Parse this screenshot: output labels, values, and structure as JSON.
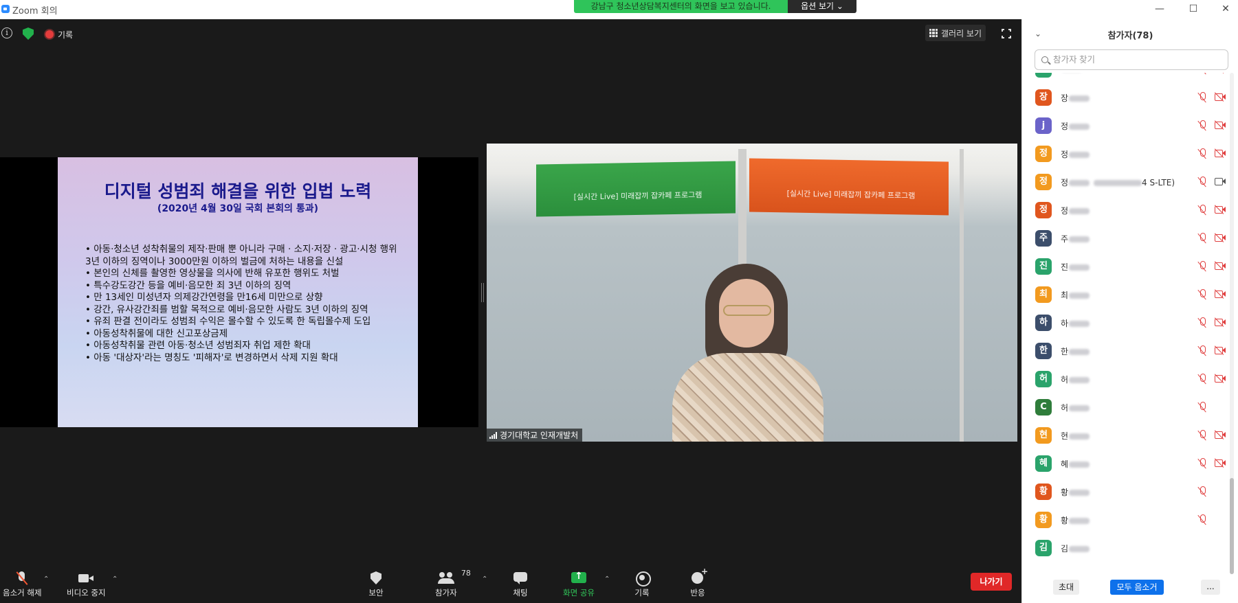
{
  "window": {
    "title": "Zoom 회의",
    "share_banner": "강남구 청소년상담복지센터의 화면을 보고 있습니다.",
    "view_options": "옵션 보기 ⌄",
    "minimize": "—",
    "maximize": "☐",
    "close": "✕"
  },
  "meeting": {
    "info_glyph": "i",
    "recording_label": "기록",
    "gallery_label": "갤러리 보기"
  },
  "slide": {
    "title": "디지털 성범죄 해결을 위한 입법 노력",
    "subtitle": "(2020년 4월 30일 국회 본회의 통과)",
    "bullets": [
      "• 아동·청소년 성착취물의 제작·판매 뿐 아니라 구매 · 소지·저장 · 광고·시청 행위 3년 이하의 징역이나 3000만원 이하의 벌금에 처하는 내용을 신설",
      "• 본인의 신체를 촬영한 영상물을 의사에 반해 유포한 행위도 처벌",
      "• 특수강도강간 등을 예비·음모한 죄 3년 이하의 징역",
      "• 만 13세인 미성년자 의제강간연령을 만16세 미만으로 상향",
      "• 강간, 유사강간죄를 범할 목적으로 예비·음모한 사람도 3년 이하의 징역",
      "• 유죄 판결 전이라도 성범죄 수익은 몰수할 수 있도록 한 독립몰수제 도입",
      "• 아동성착취물에 대한 신고포상금제",
      "• 아동성착취물 관련 아동·청소년 성범죄자 취업 제한 확대",
      "• 아동 '대상자'라는 명칭도 '피해자'로 변경하면서 삭제 지원 확대"
    ]
  },
  "video": {
    "name_label": "경기대학교 인재개발처",
    "banner_green_text": "[실시간 Live] 미래잡끼 잡카페 프로그램",
    "banner_orange_text": "[실시간 Live] 미래잡끼 잡카페 프로그램"
  },
  "toolbar": {
    "unmute": "음소거 해제",
    "stop_video": "비디오 중지",
    "security": "보안",
    "participants": "참가자",
    "participants_count": "78",
    "chat": "채팅",
    "share_screen": "화면 공유",
    "record": "기록",
    "reactions": "반응",
    "leave": "나가기",
    "caret": "⌃"
  },
  "participants_panel": {
    "title": "참가자(78)",
    "collapse_glyph": "⌄",
    "search_placeholder": "참가자 찾기",
    "invite": "초대",
    "mute_all": "모두 음소거",
    "more": "...",
    "rows": [
      {
        "initial": "진",
        "color": "#2aa36b",
        "name": "",
        "mic_muted": true,
        "camera": "off"
      },
      {
        "initial": "장",
        "color": "#e0561e",
        "name": "장",
        "mic_muted": true,
        "camera": "off"
      },
      {
        "initial": "j",
        "color": "#6b63c9",
        "name": "정",
        "mic_muted": true,
        "camera": "off"
      },
      {
        "initial": "정",
        "color": "#f29a1f",
        "name": "정",
        "mic_muted": true,
        "camera": "off"
      },
      {
        "initial": "정",
        "color": "#f29a1f",
        "name": "정",
        "name_suffix": "4 S-LTE)",
        "mic_muted": true,
        "camera": "on"
      },
      {
        "initial": "정",
        "color": "#e0561e",
        "name": "정",
        "mic_muted": true,
        "camera": "off"
      },
      {
        "initial": "주",
        "color": "#3c4e6b",
        "name": "주",
        "mic_muted": true,
        "camera": "off"
      },
      {
        "initial": "진",
        "color": "#2aa36b",
        "name": "진",
        "mic_muted": true,
        "camera": "off"
      },
      {
        "initial": "최",
        "color": "#f29a1f",
        "name": "최",
        "mic_muted": true,
        "camera": "off"
      },
      {
        "initial": "하",
        "color": "#3c4e6b",
        "name": "하",
        "mic_muted": true,
        "camera": "off"
      },
      {
        "initial": "한",
        "color": "#3c4e6b",
        "name": "한",
        "mic_muted": true,
        "camera": "off"
      },
      {
        "initial": "허",
        "color": "#2aa36b",
        "name": "허",
        "mic_muted": true,
        "camera": "off"
      },
      {
        "initial": "C",
        "color": "#2f7d3b",
        "name": "허",
        "mic_muted": true,
        "camera": "none"
      },
      {
        "initial": "현",
        "color": "#f29a1f",
        "name": "현",
        "mic_muted": true,
        "camera": "off"
      },
      {
        "initial": "혜",
        "color": "#2aa36b",
        "name": "혜",
        "mic_muted": true,
        "camera": "off"
      },
      {
        "initial": "황",
        "color": "#e0561e",
        "name": "황",
        "mic_muted": true,
        "camera": "none"
      },
      {
        "initial": "황",
        "color": "#f29a1f",
        "name": "황",
        "mic_muted": true,
        "camera": "none"
      },
      {
        "initial": "김",
        "color": "#2aa36b",
        "name": "김",
        "mic_muted": false,
        "camera": "none"
      }
    ]
  }
}
